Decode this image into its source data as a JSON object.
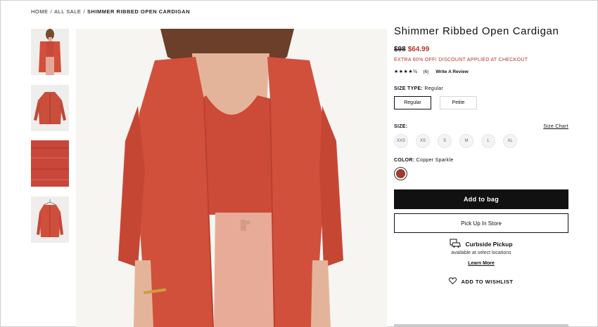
{
  "breadcrumb": {
    "home": "HOME",
    "sep1": "/",
    "all_sale": "ALL SALE",
    "sep2": "/",
    "current": "SHIMMER RIBBED OPEN CARDIGAN"
  },
  "gallery": {
    "thumbnails": [
      "model-front",
      "flat-lay",
      "fabric-detail",
      "hanger"
    ],
    "main_image": "model-wearing-cardigan"
  },
  "product": {
    "title": "Shimmer Ribbed Open Cardigan",
    "price_original": "$98",
    "price_sale": "$64.99",
    "promo": "EXTRA 60% OFF! DISCOUNT APPLIED AT CHECKOUT",
    "rating_stars": "★★★★½",
    "rating_value": 4.5,
    "review_count": "(6)",
    "write_review": "Write A Review"
  },
  "size_type": {
    "label": "SIZE TYPE:",
    "value": "Regular",
    "options": [
      "Regular",
      "Petite"
    ],
    "selected": "Regular"
  },
  "size": {
    "label": "SIZE:",
    "chart_link": "Size Chart",
    "options": [
      "XXS",
      "XS",
      "S",
      "M",
      "L",
      "XL"
    ]
  },
  "color": {
    "label": "COLOR:",
    "value": "Copper Sparkle",
    "swatch_hex": "#a23a2e"
  },
  "actions": {
    "add_to_bag": "Add to bag",
    "pick_up": "Pick Up In Store",
    "wishlist": "ADD TO WISHLIST"
  },
  "curbside": {
    "title": "Curbside Pickup",
    "subtitle": "available at select locations",
    "learn_more": "Learn More"
  },
  "colors": {
    "accent_red": "#b5362a",
    "cardigan": "#d1503c",
    "pants": "#e6a796"
  }
}
